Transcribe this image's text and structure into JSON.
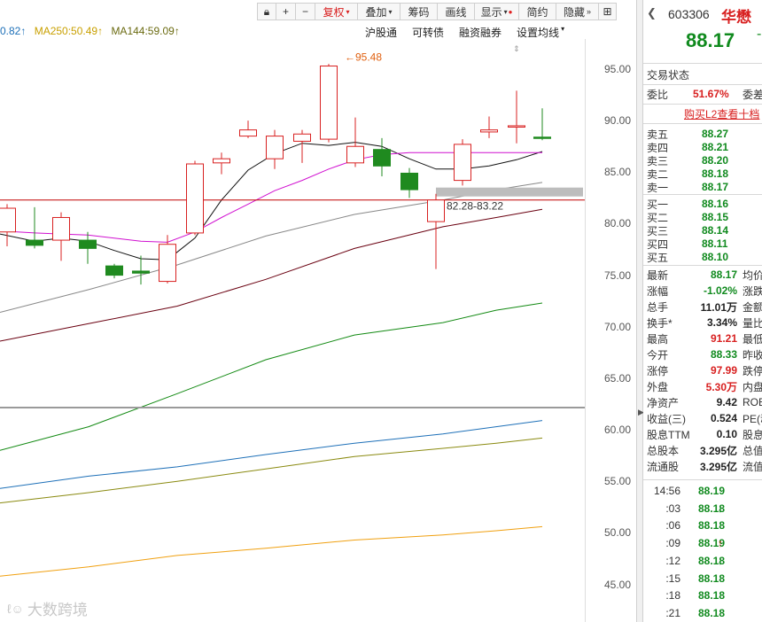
{
  "toolbar": {
    "items": [
      "复权",
      "叠加",
      "筹码",
      "画线",
      "显示",
      "简约",
      "隐藏"
    ],
    "restore_label": "复权",
    "overlay_label": "叠加",
    "chips_label": "筹码",
    "draw_label": "画线",
    "display_label": "显示",
    "simple_label": "简约",
    "hide_label": "隐藏"
  },
  "ma_legend": {
    "first": "0.82",
    "ma250": "MA250:50.49",
    "ma144": "MA144:59.09"
  },
  "links": {
    "hk_connect": "沪股通",
    "convertible": "可转债",
    "margin": "融资融券",
    "set_ma": "设置均线"
  },
  "annotations": {
    "high_label": "95.48",
    "range_label": "82.28-83.22"
  },
  "chart_data": {
    "type": "candlestick",
    "y_axis_ticks": [
      "95.00",
      "90.00",
      "85.00",
      "80.00",
      "75.00",
      "70.00",
      "65.00",
      "60.00",
      "55.00",
      "50.00",
      "45.00"
    ],
    "ylim": [
      44.0,
      98.0
    ],
    "candles": [
      {
        "open": 79.2,
        "close": 81.5,
        "high": 81.9,
        "low": 77.8
      },
      {
        "open": 78.4,
        "close": 77.9,
        "high": 81.6,
        "low": 77.6
      },
      {
        "open": 78.4,
        "close": 80.6,
        "high": 81.1,
        "low": 76.4
      },
      {
        "open": 78.4,
        "close": 77.6,
        "high": 79.2,
        "low": 76.1
      },
      {
        "open": 75.9,
        "close": 75.0,
        "high": 76.1,
        "low": 74.7
      },
      {
        "open": 75.4,
        "close": 75.2,
        "high": 76.9,
        "low": 74.1
      },
      {
        "open": 74.4,
        "close": 78.0,
        "high": 78.9,
        "low": 74.2
      },
      {
        "open": 79.1,
        "close": 85.8,
        "high": 86.1,
        "low": 78.9
      },
      {
        "open": 85.9,
        "close": 86.3,
        "high": 86.9,
        "low": 84.8
      },
      {
        "open": 88.5,
        "close": 89.1,
        "high": 90.0,
        "low": 88.3
      },
      {
        "open": 86.3,
        "close": 88.5,
        "high": 89.1,
        "low": 85.3
      },
      {
        "open": 88.0,
        "close": 88.7,
        "high": 89.1,
        "low": 85.9
      },
      {
        "open": 88.2,
        "close": 95.3,
        "high": 95.5,
        "low": 87.9
      },
      {
        "open": 85.9,
        "close": 87.5,
        "high": 90.3,
        "low": 85.5
      },
      {
        "open": 87.2,
        "close": 85.6,
        "high": 88.3,
        "low": 84.6
      },
      {
        "open": 84.9,
        "close": 83.3,
        "high": 85.4,
        "low": 82.5
      },
      {
        "open": 80.2,
        "close": 82.3,
        "high": 82.9,
        "low": 75.6
      },
      {
        "open": 84.2,
        "close": 87.7,
        "high": 88.2,
        "low": 83.7
      },
      {
        "open": 88.9,
        "close": 89.1,
        "high": 90.4,
        "low": 88.3
      },
      {
        "open": 89.5,
        "close": 89.5,
        "high": 92.9,
        "low": 87.8
      },
      {
        "open": 88.4,
        "close": 88.3,
        "high": 91.2,
        "low": 88.1
      }
    ],
    "x_positions": [
      8,
      39,
      69,
      99,
      129,
      159,
      189,
      220,
      250,
      280,
      310,
      341,
      371,
      401,
      431,
      462,
      492,
      522,
      552,
      583,
      612
    ],
    "resistance_line": 82.3,
    "series_lines": [
      {
        "color": "#111111",
        "points": [
          [
            0,
            79.0
          ],
          [
            39,
            78.3
          ],
          [
            69,
            78.6
          ],
          [
            99,
            78.3
          ],
          [
            129,
            77.4
          ],
          [
            159,
            76.6
          ],
          [
            189,
            76.5
          ],
          [
            220,
            78.6
          ],
          [
            250,
            82.3
          ],
          [
            280,
            85.2
          ],
          [
            310,
            86.8
          ],
          [
            341,
            87.8
          ],
          [
            371,
            87.6
          ],
          [
            401,
            87.9
          ],
          [
            431,
            87.5
          ],
          [
            462,
            86.3
          ],
          [
            492,
            85.3
          ],
          [
            522,
            85.3
          ],
          [
            552,
            85.6
          ],
          [
            583,
            86.2
          ],
          [
            612,
            87.0
          ]
        ]
      },
      {
        "color": "#d010d0",
        "points": [
          [
            0,
            79.3
          ],
          [
            39,
            79.1
          ],
          [
            69,
            79.0
          ],
          [
            99,
            78.9
          ],
          [
            129,
            78.6
          ],
          [
            159,
            78.3
          ],
          [
            189,
            78.2
          ],
          [
            220,
            79.2
          ],
          [
            250,
            80.6
          ],
          [
            280,
            81.9
          ],
          [
            310,
            83.2
          ],
          [
            341,
            84.2
          ],
          [
            371,
            85.3
          ],
          [
            401,
            86.2
          ],
          [
            431,
            86.7
          ],
          [
            462,
            86.9
          ],
          [
            492,
            86.9
          ],
          [
            522,
            86.9
          ],
          [
            552,
            86.9
          ],
          [
            583,
            86.9
          ],
          [
            612,
            86.9
          ]
        ]
      },
      {
        "color": "#888888",
        "points": [
          [
            0,
            71.4
          ],
          [
            100,
            73.6
          ],
          [
            200,
            76.0
          ],
          [
            300,
            78.8
          ],
          [
            400,
            80.9
          ],
          [
            500,
            82.3
          ],
          [
            560,
            83.3
          ],
          [
            612,
            84.0
          ]
        ]
      },
      {
        "color": "#6a0010",
        "points": [
          [
            0,
            68.6
          ],
          [
            100,
            70.3
          ],
          [
            200,
            72.0
          ],
          [
            300,
            74.6
          ],
          [
            400,
            77.6
          ],
          [
            500,
            79.7
          ],
          [
            560,
            80.6
          ],
          [
            612,
            81.4
          ]
        ]
      },
      {
        "color": "#138a13",
        "points": [
          [
            0,
            58.0
          ],
          [
            100,
            60.3
          ],
          [
            200,
            63.5
          ],
          [
            300,
            66.8
          ],
          [
            400,
            69.2
          ],
          [
            500,
            70.4
          ],
          [
            560,
            71.6
          ],
          [
            612,
            72.3
          ]
        ]
      },
      {
        "color": "#1e70b8",
        "points": [
          [
            0,
            54.3
          ],
          [
            100,
            55.5
          ],
          [
            200,
            56.4
          ],
          [
            300,
            57.6
          ],
          [
            400,
            58.7
          ],
          [
            500,
            59.6
          ],
          [
            560,
            60.3
          ],
          [
            612,
            60.9
          ]
        ]
      },
      {
        "color": "#8a8a10",
        "points": [
          [
            0,
            52.9
          ],
          [
            100,
            53.9
          ],
          [
            200,
            55.0
          ],
          [
            300,
            56.2
          ],
          [
            400,
            57.4
          ],
          [
            500,
            58.2
          ],
          [
            560,
            58.7
          ],
          [
            612,
            59.2
          ]
        ]
      },
      {
        "color": "#f0a010",
        "points": [
          [
            0,
            45.8
          ],
          [
            100,
            46.7
          ],
          [
            200,
            47.8
          ],
          [
            300,
            48.5
          ],
          [
            400,
            49.3
          ],
          [
            500,
            49.8
          ],
          [
            560,
            50.2
          ],
          [
            612,
            50.6
          ]
        ]
      }
    ]
  },
  "quote": {
    "code": "603306",
    "name": "华懋",
    "price": "88.17",
    "status_label": "交易状态",
    "ratio_label": "委比",
    "ratio_value": "51.67%",
    "ratio_label2": "委差",
    "l2_link": "购买L2查看十档",
    "asks": [
      {
        "label": "卖五",
        "price": "88.27"
      },
      {
        "label": "卖四",
        "price": "88.21"
      },
      {
        "label": "卖三",
        "price": "88.20"
      },
      {
        "label": "卖二",
        "price": "88.18"
      },
      {
        "label": "卖一",
        "price": "88.17"
      }
    ],
    "bids": [
      {
        "label": "买一",
        "price": "88.16"
      },
      {
        "label": "买二",
        "price": "88.15"
      },
      {
        "label": "买三",
        "price": "88.14"
      },
      {
        "label": "买四",
        "price": "88.11"
      },
      {
        "label": "买五",
        "price": "88.10"
      }
    ],
    "stats": [
      {
        "label": "最新",
        "value": "88.17",
        "color": "green",
        "label2": "均价"
      },
      {
        "label": "涨幅",
        "value": "-1.02%",
        "color": "green",
        "label2": "涨跌"
      },
      {
        "label": "总手",
        "value": "11.01万",
        "color": "black",
        "label2": "金额"
      },
      {
        "label": "换手*",
        "value": "3.34%",
        "color": "black",
        "label2": "量比"
      },
      {
        "label": "最高",
        "value": "91.21",
        "color": "red",
        "label2": "最低"
      },
      {
        "label": "今开",
        "value": "88.33",
        "color": "green",
        "label2": "昨收"
      },
      {
        "label": "涨停",
        "value": "97.99",
        "color": "red",
        "label2": "跌停"
      },
      {
        "label": "外盘",
        "value": "5.30万",
        "color": "red",
        "label2": "内盘"
      },
      {
        "label": "净资产",
        "value": "9.42",
        "color": "black",
        "label2": "ROE"
      },
      {
        "label": "收益(三)",
        "value": "0.524",
        "color": "black",
        "label2": "PE(动)"
      },
      {
        "label": "股息TTM",
        "value": "0.10",
        "color": "black",
        "label2": "股息率"
      },
      {
        "label": "总股本",
        "value": "3.295亿",
        "color": "black",
        "label2": "总值"
      },
      {
        "label": "流通股",
        "value": "3.295亿",
        "color": "black",
        "label2": "流值"
      }
    ],
    "ticks": [
      {
        "time": "14:56",
        "price": "88.19",
        "arrow": ""
      },
      {
        "time": ":03",
        "price": "88.18",
        "arrow": "↓"
      },
      {
        "time": ":06",
        "price": "88.18",
        "arrow": ""
      },
      {
        "time": ":09",
        "price": "88.19",
        "arrow": "↑"
      },
      {
        "time": ":12",
        "price": "88.18",
        "arrow": "↓"
      },
      {
        "time": ":15",
        "price": "88.18",
        "arrow": ""
      },
      {
        "time": ":18",
        "price": "88.18",
        "arrow": ""
      },
      {
        "time": ":21",
        "price": "88.18",
        "arrow": ""
      }
    ]
  },
  "watermark": "大数跨境",
  "colors": {
    "up": "#d82020",
    "down": "#1f8a1f",
    "hline": "#c00000"
  }
}
